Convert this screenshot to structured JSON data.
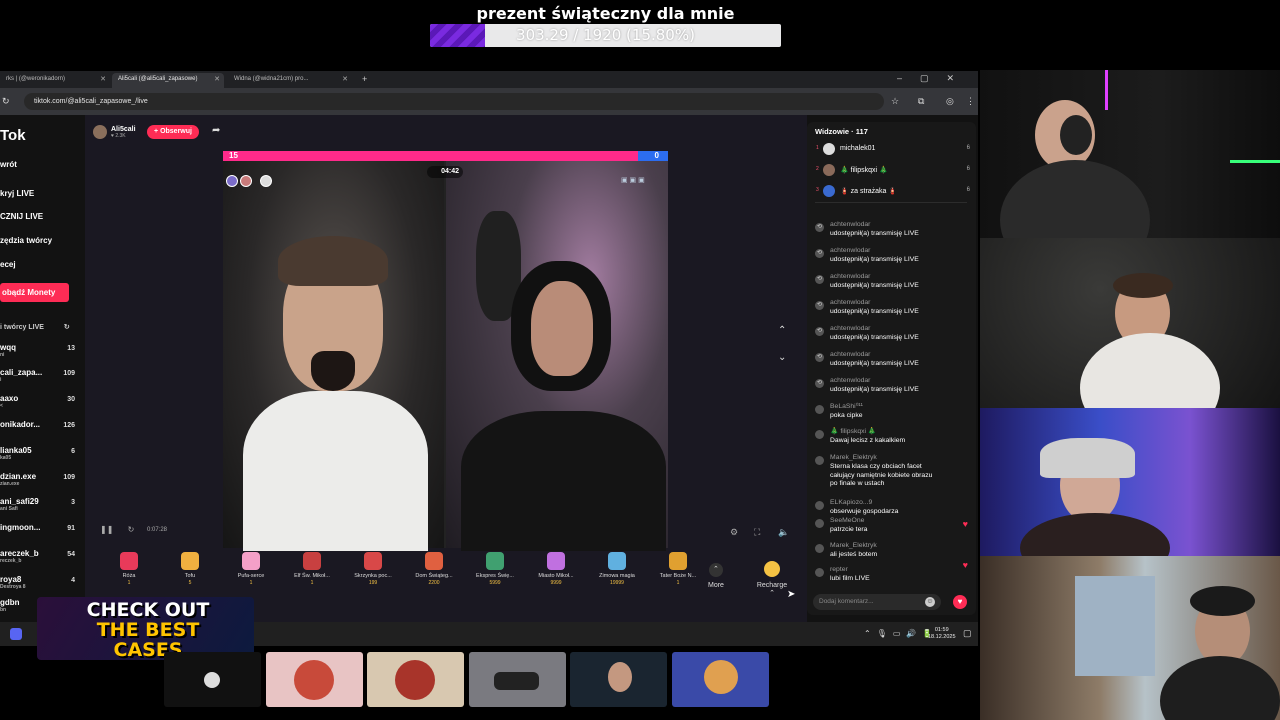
{
  "goal": {
    "title": "prezent świąteczny dla mnie",
    "progress_text": "303.29 / 1920 (15.80%)",
    "progress_fraction": 0.158
  },
  "browser": {
    "tabs": [
      {
        "label": "rks | (@weronikadorn)"
      },
      {
        "label": "Ali5cali (@ali5cali_zapasowe)",
        "active": true
      },
      {
        "label": "Widna (@widna21cm) pro..."
      }
    ],
    "url": "tiktok.com/@ali5cali_zapasowe_/live"
  },
  "sidebar": {
    "logo": "Tok",
    "nav": [
      "wrót",
      "kryj LIVE",
      "CZNIJ LIVE",
      "zędzia twórcy",
      "ecej"
    ],
    "coins_button": "obądź Monety",
    "creators_heading": "i twórcy LIVE",
    "creators": [
      {
        "name": "wqq",
        "sub": "ni",
        "count": "13"
      },
      {
        "name": "cali_zapa...",
        "sub": "i",
        "count": "109"
      },
      {
        "name": "aaxo",
        "sub": "<",
        "count": "30"
      },
      {
        "name": "onikador...",
        "sub": "",
        "count": "126"
      },
      {
        "name": "lianka05",
        "sub": "ka05",
        "count": "6"
      },
      {
        "name": "dzian.exe",
        "sub": "zian.exe",
        "count": "109"
      },
      {
        "name": "ani_safi29",
        "sub": "ani Safi",
        "count": "3"
      },
      {
        "name": "ingmoon...",
        "sub": "",
        "count": "91"
      },
      {
        "name": "areczek_b",
        "sub": "reczek_b",
        "count": "54"
      },
      {
        "name": "roya8",
        "sub": "Destroya 8",
        "count": "4"
      },
      {
        "name": "gdbn",
        "sub": "bn",
        "count": ""
      }
    ]
  },
  "stream": {
    "host_name": "Ali5cali",
    "host_likes": "♥ 2.3K",
    "follow_label": "+ Obserwuj",
    "pk_left_score": "15",
    "pk_right_score": "0",
    "timer": "04:42",
    "elapsed": "0:07:28"
  },
  "gifts": [
    {
      "name": "Róża",
      "price": "1"
    },
    {
      "name": "Tofu",
      "price": "5"
    },
    {
      "name": "Pufa-serce",
      "price": "1"
    },
    {
      "name": "Elf Św. Mikoł...",
      "price": "1"
    },
    {
      "name": "Skrzynka poc...",
      "price": "199"
    },
    {
      "name": "Dom Świąteg...",
      "price": "2200"
    },
    {
      "name": "Ekspres Świę...",
      "price": "5999"
    },
    {
      "name": "Miasto Mikoł...",
      "price": "9999"
    },
    {
      "name": "Zimowa magia",
      "price": "19999"
    },
    {
      "name": "Tater Boże N...",
      "price": "1"
    }
  ],
  "more_label": "More",
  "recharge_label": "Recharge",
  "chat": {
    "viewers_heading": "Widzowie · 117",
    "viewers": [
      {
        "rank": "1",
        "name": "michalek01",
        "score": "6"
      },
      {
        "rank": "2",
        "name": "🎄 filipskqxi 🎄",
        "score": "6"
      },
      {
        "rank": "3",
        "name": "🧯 za strażaka 🧯",
        "score": "6"
      }
    ],
    "messages": [
      {
        "user": "achtenwlodar",
        "text": "udostępnił(a) transmisję LIVE"
      },
      {
        "user": "achtenwlodar",
        "text": "udostępnił(a) transmisję LIVE"
      },
      {
        "user": "achtenwlodar",
        "text": "udostępnił(a) transmisję LIVE"
      },
      {
        "user": "achtenwlodar",
        "text": "udostępnił(a) transmisję LIVE"
      },
      {
        "user": "achtenwlodar",
        "text": "udostępnił(a) transmisję LIVE"
      },
      {
        "user": "achtenwlodar",
        "text": "udostępnił(a) transmisję LIVE"
      },
      {
        "user": "achtenwlodar",
        "text": "udostępnił(a) transmisję LIVE"
      },
      {
        "user": "BeLaShi⁰¹¹",
        "text": "poka cipke"
      },
      {
        "user": "🎄 filipskqxi 🎄",
        "text": "Dawaj lecisz z kakalkiem"
      },
      {
        "user": "Marek_Elektryk",
        "text": "Sterna klasa czy obciach facet\ncałujący namiętnie kobiete obrazu\npo finale w ustach"
      },
      {
        "user": "ELKapiozo...9",
        "text": "obserwuje gospodarza"
      },
      {
        "user": "SeeMeOne",
        "text": "patrzcie tera"
      },
      {
        "user": "Marek_Elektryk",
        "text": "ali jesteś botem"
      },
      {
        "user": "repter",
        "text": "lubi film LIVE"
      }
    ],
    "comment_placeholder": "Dodaj komentarz..."
  },
  "taskbar": {
    "time": "01:59",
    "date": "18.12.2025"
  },
  "promo": {
    "line1": "CHECK OUT",
    "line2": "THE BEST",
    "line3": "CASES"
  },
  "colors": {
    "tiktok_red": "#fe2c55",
    "goal_fill": "#7a2ae0",
    "pk_pink": "#ff2a8a",
    "pk_blue": "#2c6df0"
  }
}
